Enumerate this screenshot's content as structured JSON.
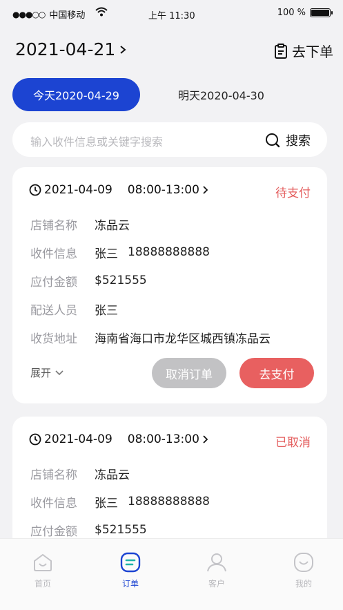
{
  "status_bar": {
    "carrier": "中国移动",
    "time": "上午 11:30",
    "battery": "100 %"
  },
  "header": {
    "date": "2021-04-21",
    "order_link": "去下单"
  },
  "day_tabs": {
    "today": "今天2020-04-29",
    "tomorrow": "明天2020-04-30"
  },
  "search": {
    "placeholder": "输入收件信息或关键字搜索",
    "button": "搜索"
  },
  "labels": {
    "shop": "店铺名称",
    "receiver": "收件信息",
    "amount": "应付金额",
    "courier": "配送人员",
    "address": "收货地址"
  },
  "orders": [
    {
      "date": "2021-04-09",
      "time_range": "08:00-13:00",
      "status": "待支付",
      "shop": "冻品云",
      "receiver_name": "张三",
      "receiver_phone": "18888888888",
      "amount": "$521555",
      "courier": "张三",
      "address": "海南省海口市龙华区城西镇冻品云",
      "expand": "展开",
      "cancel_button": "取消订单",
      "pay_button": "去支付"
    },
    {
      "date": "2021-04-09",
      "time_range": "08:00-13:00",
      "status": "已取消",
      "shop": "冻品云",
      "receiver_name": "张三",
      "receiver_phone": "18888888888",
      "amount": "$521555"
    }
  ],
  "tabbar": {
    "home": "首页",
    "orders": "订单",
    "customers": "客户",
    "mine": "我的"
  },
  "colors": {
    "accent": "#1c44d2",
    "alert": "#e45f5f",
    "muted": "#9a9aa0"
  }
}
